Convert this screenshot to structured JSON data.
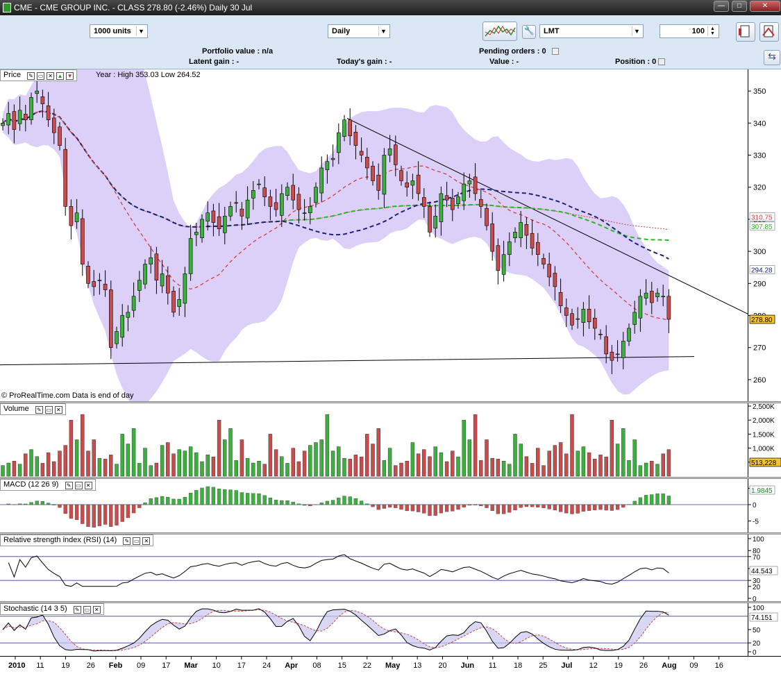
{
  "window": {
    "title": "CME - CME GROUP INC. - CLASS    278.80 (-2.46%)    Daily  30 Jul",
    "min_label": "—",
    "max_label": "□",
    "close_label": "✕"
  },
  "toolbar": {
    "units": "1000 units",
    "period": "Daily",
    "symbol": "LMT",
    "quantity": "100",
    "portfolio_value": "Portfolio value : n/a",
    "pending_orders": "Pending orders : 0",
    "latent_gain": "Latent gain : -",
    "todays_gain": "Today's gain : -",
    "value": "Value : -",
    "position": "Position : 0"
  },
  "panels": {
    "price": {
      "label": "Price",
      "info": "Year : High 353.03 Low 264.52",
      "footer": "© ProRealTime.com  Data is end of day"
    },
    "volume": {
      "label": "Volume"
    },
    "macd": {
      "label": "MACD (12 26 9)"
    },
    "rsi": {
      "label": "Relative strength index (RSI) (14)"
    },
    "stoch": {
      "label": "Stochastic (14 3 5)"
    }
  },
  "colors": {
    "up": "#3cb03c",
    "down": "#c84c4c",
    "bollinger": "#dcd0f8",
    "ma_short": "#d04040",
    "ma_mid": "#1a237e",
    "ma_long": "#22bb22",
    "ma_very_long": "#d04040",
    "highlight": "#f5c230"
  },
  "chart_data": {
    "type": "candlestick",
    "x_ticks": [
      "2010",
      "11",
      "19",
      "26",
      "Feb",
      "09",
      "17",
      "Mar",
      "10",
      "17",
      "24",
      "Apr",
      "08",
      "15",
      "22",
      "May",
      "13",
      "20",
      "Jun",
      "11",
      "18",
      "25",
      "Jul",
      "12",
      "19",
      "26",
      "Aug",
      "09",
      "16"
    ],
    "price": {
      "yticks": [
        "350",
        "340",
        "330",
        "320",
        "310",
        "300",
        "290",
        "280",
        "270",
        "260"
      ],
      "ylim": [
        255,
        355
      ],
      "year_high": 353.03,
      "year_low": 264.52,
      "last": "278.80",
      "last_change": "-2.46%",
      "labels": [
        {
          "value": "310.75",
          "color": "#d04040"
        },
        {
          "value": "307.85",
          "color": "#22bb22"
        },
        {
          "value": "294.28",
          "color": "#1a237e"
        },
        {
          "value": "278.80",
          "color": "#f5c230"
        }
      ],
      "close_series": [
        340,
        343,
        338,
        344,
        341,
        348,
        350,
        346,
        341,
        337,
        333,
        314,
        308,
        312,
        296,
        290,
        289,
        291,
        288,
        270,
        275,
        280,
        281,
        286,
        291,
        296,
        298,
        291,
        293,
        287,
        281,
        285,
        293,
        304,
        306,
        310,
        312,
        309,
        307,
        311,
        314,
        315,
        311,
        316,
        319,
        321,
        317,
        314,
        313,
        318,
        320,
        316,
        313,
        312,
        314,
        320,
        326,
        328,
        329,
        337,
        341,
        336,
        333,
        330,
        326,
        322,
        319,
        330,
        332,
        327,
        322,
        320,
        322,
        318,
        314,
        306,
        311,
        318,
        316,
        313,
        317,
        321,
        322,
        318,
        314,
        308,
        300,
        294,
        299,
        303,
        306,
        309,
        305,
        301,
        299,
        296,
        292,
        289,
        283,
        280,
        277,
        279,
        282,
        278,
        276,
        274,
        268,
        266,
        268,
        272,
        276,
        281,
        286,
        287,
        284,
        287,
        286,
        278.8
      ]
    },
    "volume": {
      "yticks": [
        "2,500K",
        "2,000K",
        "1,500K",
        "1,000K",
        "500K"
      ],
      "last": "513,228",
      "ylim": [
        0,
        2500000
      ]
    },
    "macd": {
      "yticks": [
        "5",
        "0",
        "-5"
      ],
      "last": "1.9845",
      "ylim": [
        -7,
        7
      ]
    },
    "rsi": {
      "yticks": [
        "100",
        "80",
        "70",
        "50",
        "30",
        "20",
        "0"
      ],
      "last": "44.543",
      "bands": [
        70,
        30
      ],
      "ylim": [
        0,
        100
      ]
    },
    "stochastic": {
      "yticks": [
        "100",
        "50",
        "20",
        "0"
      ],
      "last": "74.151",
      "bands": [
        80,
        20
      ],
      "ylim": [
        0,
        100
      ]
    }
  }
}
